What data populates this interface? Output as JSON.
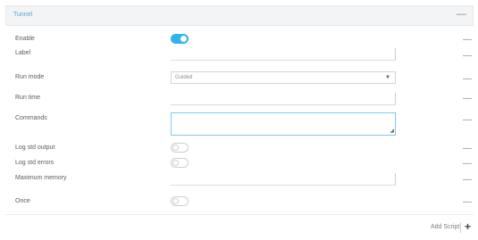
{
  "panel": {
    "title": "Tunnel",
    "collapse_glyph": "—"
  },
  "fields": {
    "enable": {
      "label": "Enable",
      "toggle": "on"
    },
    "label": {
      "label": "Label"
    },
    "run_mode": {
      "label": "Run mode",
      "value": "Guided"
    },
    "run_time": {
      "label": "Run time"
    },
    "commands": {
      "label": "Commands"
    },
    "log_stdout": {
      "label": "Log std output",
      "toggle": "off"
    },
    "log_stderr": {
      "label": "Log std errors",
      "toggle": "off"
    },
    "max_memory": {
      "label": "Maximum memory"
    },
    "once": {
      "label": "Once",
      "toggle": "off"
    }
  },
  "remove_glyph": "—",
  "add_script": {
    "label": "Add Script",
    "icon": "plus-icon",
    "glyph": "+"
  },
  "colors": {
    "accent": "#2fb3e9",
    "header_bg": "#f3f4f5",
    "title": "#5ba4d6"
  }
}
